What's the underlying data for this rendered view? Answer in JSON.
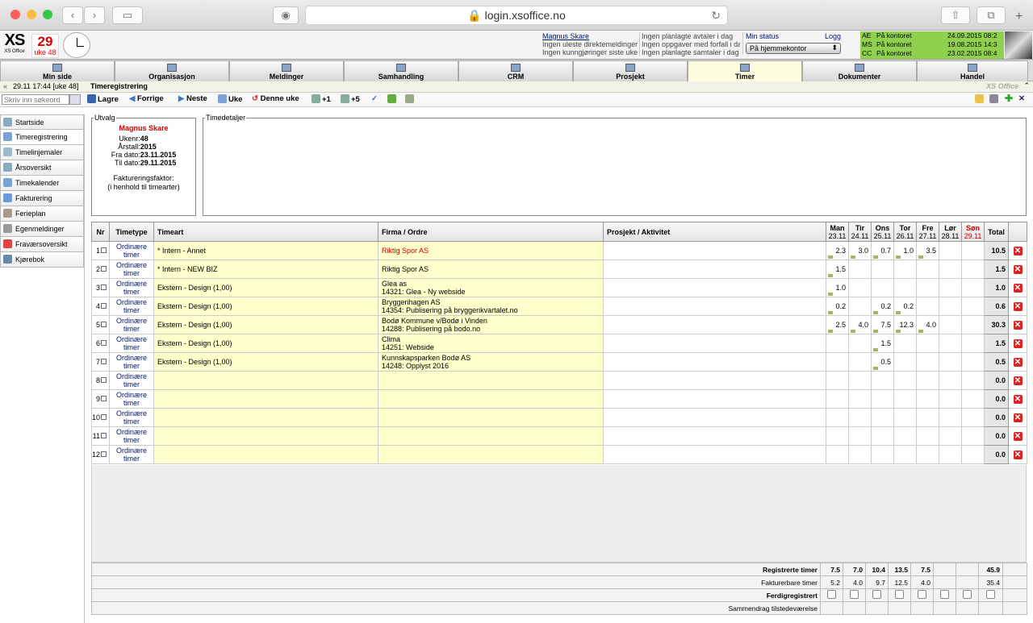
{
  "browser": {
    "url": "login.xsoffice.no"
  },
  "header": {
    "logo": "XS",
    "logo_sub": "XS Office",
    "date_day": "29",
    "week": "uke 48",
    "user_link": "Magnus Skare",
    "msg1": "Ingen uleste direktemeldinger",
    "msg2": "Ingen kunngjøringer siste uke",
    "plan1": "Ingen planlagte avtaler i dag",
    "plan2": "Ingen oppgaver med forfall i dag",
    "plan3": "Ingen planlagte samtaler i dag",
    "status_label": "Min status",
    "logg": "Logg",
    "status_value": "På hjemmekontor",
    "presence": [
      {
        "code": "AE",
        "state": "På kontoret",
        "date": "24.09.2015 08:2"
      },
      {
        "code": "MS",
        "state": "På kontoret",
        "date": "19.08.2015 14:3"
      },
      {
        "code": "CC",
        "state": "På kontoret",
        "date": "23.02.2015 08:4"
      }
    ]
  },
  "tabs": [
    "Min side",
    "Organisasjon",
    "Meldinger",
    "Samhandling",
    "CRM",
    "Prosjekt",
    "Timer",
    "Dokumenter",
    "Handel"
  ],
  "crumb": {
    "time": "29.11 17:44 [uke 48]",
    "title": "Timeregistrering",
    "brand": "XS Office"
  },
  "toolbar": {
    "search_placeholder": "Skriv inn søkeord",
    "save": "Lagre",
    "prev": "Forrige",
    "next": "Neste",
    "week": "Uke",
    "this_week": "Denne uke",
    "plus1": "+1",
    "plus5": "+5"
  },
  "sidebar": [
    "Startside",
    "Timeregistrering",
    "Timelinjemaler",
    "Årsoversikt",
    "Timekalender",
    "Fakturering",
    "Ferieplan",
    "Egenmeldinger",
    "Fraværsoversikt",
    "Kjørebok"
  ],
  "utvalg": {
    "legend": "Utvalg",
    "name": "Magnus Skare",
    "ukenr_label": "Ukenr:",
    "ukenr": "48",
    "aarstall_label": "Årstall:",
    "aarstall": "2015",
    "fra_label": "Fra dato:",
    "fra": "23.11.2015",
    "til_label": "Til dato:",
    "til": "29.11.2015",
    "faktor1": "Faktureringsfaktor:",
    "faktor2": "(i henhold til timearter)"
  },
  "timedetaljer": {
    "legend": "Timedetaljer"
  },
  "grid": {
    "headers": {
      "nr": "Nr",
      "timetype": "Timetype",
      "timeart": "Timeart",
      "firma": "Firma / Ordre",
      "prosjekt": "Prosjekt / Aktivitet",
      "total": "Total"
    },
    "days": [
      {
        "name": "Man",
        "date": "23.11"
      },
      {
        "name": "Tir",
        "date": "24.11"
      },
      {
        "name": "Ons",
        "date": "25.11"
      },
      {
        "name": "Tor",
        "date": "26.11"
      },
      {
        "name": "Fre",
        "date": "27.11"
      },
      {
        "name": "Lør",
        "date": "28.11"
      },
      {
        "name": "Søn",
        "date": "29.11"
      }
    ],
    "rows": [
      {
        "nr": "1",
        "type": "Ordinære timer",
        "art": "* Intern - Annet",
        "firma": "Riktig Spor AS",
        "ordre": "",
        "red": true,
        "days": [
          "2.3",
          "3.0",
          "0.7",
          "1.0",
          "3.5",
          "",
          ""
        ],
        "total": "10.5"
      },
      {
        "nr": "2",
        "type": "Ordinære timer",
        "art": "* Intern - NEW BIZ",
        "firma": "Riktig Spor AS",
        "ordre": "",
        "red": false,
        "days": [
          "1.5",
          "",
          "",
          "",
          "",
          "",
          ""
        ],
        "total": "1.5"
      },
      {
        "nr": "3",
        "type": "Ordinære timer",
        "art": "Ekstern - Design (1,00)",
        "firma": "Glea as",
        "ordre": "14321: Glea - Ny webside",
        "red": false,
        "days": [
          "1.0",
          "",
          "",
          "",
          "",
          "",
          ""
        ],
        "total": "1.0"
      },
      {
        "nr": "4",
        "type": "Ordinære timer",
        "art": "Ekstern - Design (1,00)",
        "firma": "Bryggerihagen AS",
        "ordre": "14354: Publisering på bryggerikvartalet.no",
        "red": false,
        "days": [
          "0.2",
          "",
          "0.2",
          "0.2",
          "",
          "",
          ""
        ],
        "total": "0.6"
      },
      {
        "nr": "5",
        "type": "Ordinære timer",
        "art": "Ekstern - Design (1,00)",
        "firma": "Bodø Kommune v/Bodø i Vinden",
        "ordre": "14288: Publisering på bodo.no",
        "red": false,
        "days": [
          "2.5",
          "4.0",
          "7.5",
          "12.3",
          "4.0",
          "",
          ""
        ],
        "total": "30.3"
      },
      {
        "nr": "6",
        "type": "Ordinære timer",
        "art": "Ekstern - Design (1,00)",
        "firma": "Clima",
        "ordre": "14251: Webside",
        "red": false,
        "days": [
          "",
          "",
          "1.5",
          "",
          "",
          "",
          ""
        ],
        "total": "1.5"
      },
      {
        "nr": "7",
        "type": "Ordinære timer",
        "art": "Ekstern - Design (1,00)",
        "firma": "Kunnskapsparken Bodø AS",
        "ordre": "14248: Opplyst 2016",
        "red": false,
        "days": [
          "",
          "",
          "0.5",
          "",
          "",
          "",
          ""
        ],
        "total": "0.5"
      },
      {
        "nr": "8",
        "type": "Ordinære timer",
        "art": "",
        "firma": "",
        "ordre": "",
        "red": false,
        "days": [
          "",
          "",
          "",
          "",
          "",
          "",
          ""
        ],
        "total": "0.0"
      },
      {
        "nr": "9",
        "type": "Ordinære timer",
        "art": "",
        "firma": "",
        "ordre": "",
        "red": false,
        "days": [
          "",
          "",
          "",
          "",
          "",
          "",
          ""
        ],
        "total": "0.0"
      },
      {
        "nr": "10",
        "type": "Ordinære timer",
        "art": "",
        "firma": "",
        "ordre": "",
        "red": false,
        "days": [
          "",
          "",
          "",
          "",
          "",
          "",
          ""
        ],
        "total": "0.0"
      },
      {
        "nr": "11",
        "type": "Ordinære timer",
        "art": "",
        "firma": "",
        "ordre": "",
        "red": false,
        "days": [
          "",
          "",
          "",
          "",
          "",
          "",
          ""
        ],
        "total": "0.0"
      },
      {
        "nr": "12",
        "type": "Ordinære timer",
        "art": "",
        "firma": "",
        "ordre": "",
        "red": false,
        "days": [
          "",
          "",
          "",
          "",
          "",
          "",
          ""
        ],
        "total": "0.0"
      }
    ]
  },
  "summary": {
    "reg_label": "Registrerte timer",
    "reg": [
      "7.5",
      "7.0",
      "10.4",
      "13.5",
      "7.5",
      "",
      ""
    ],
    "reg_total": "45.9",
    "fakt_label": "Fakturerbare timer",
    "fakt": [
      "5.2",
      "4.0",
      "9.7",
      "12.5",
      "4.0",
      "",
      ""
    ],
    "fakt_total": "35.4",
    "ferdig_label": "Ferdigregistrert",
    "sammendrag_label": "Sammendrag tilstedeværelse"
  }
}
